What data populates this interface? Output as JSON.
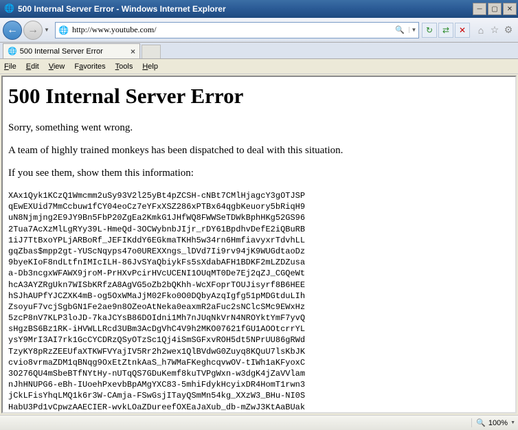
{
  "titlebar": {
    "text": "500 Internal Server Error - Windows Internet Explorer"
  },
  "address": {
    "url": "http://www.youtube.com/"
  },
  "tab": {
    "title": "500 Internal Server Error"
  },
  "menu": {
    "file": "File",
    "edit": "Edit",
    "view": "View",
    "favorites": "Favorites",
    "tools": "Tools",
    "help": "Help"
  },
  "page": {
    "heading": "500 Internal Server Error",
    "p1": "Sorry, something went wrong.",
    "p2": "A team of highly trained monkeys has been dispatched to deal with this situation.",
    "p3": "If you see them, show them this information:",
    "trace": "XAx1Qyk1KCzQ1Wmcmm2uSy93V2l25yBt4pZCSH-cNBt7CMlHjagcY3gOTJSP\nqEwEXUid7MmCcbuw1fCY04eoCz7eYFxXSZ286xPTBx64qgbKeuory5bRiqH9\nuN8Njmjng2E9JY9Bn5FbP20ZgEa2KmkG1JHfWQ8FWWSeTDWkBphHKg52GS96\n2Tua7AcXzMlLgRYy39L-HmeQd-3OCWybnbJIjr_rDY61BpdhvDefE2iQBuRB\n1iJ7TtBxoYPLjARBoRf_JEFIKddY6EGkmaTKHh5w34rn6HmfiavyxrTdvhLL\ngqZbas$mpp2gt-YUScNqyps47o0UREXXngs_lDVd7Ii9rv94jK9WUGdtaoDz\n9byeKIoF8ndLtfnIMIcILH-86JvSYaQbiykFs5sXdabAFH1BDKF2mLZDZusa\na-Db3ncgxWFAWX9jroM-PrHXvPcirHVcUCENI1OUqMT0De7Ej2qZJ_CGQeWt\nhcA3AYZRgUkn7WISbKRfzA8AgVG5oZb2bQKhh-WcXFoprTOUJisyrf8B6HEE\nhSJhAUPfYJCZXK4mB-og5OxWMaJjM02Fko0O0DQbyAzqIgfg51pMDGtduLIh\nZsoyuF7vcjSgbGN1Fe2ae9n8OZeoAtNeka0eaxmR2aFuc2sNClcSMc9EWxHz\n5zcP8nV7KLP3loJD-7kaJCYsB86DOIdni1Mh7nJUqNkVrN4NROYktYmF7yvQ\nsHgzBS6Bz1RK-iHVWLLRcd3UBm3AcDgVhC4V9h2MKO07621fGU1AOOtcrrYL\nysY9MrI3AI7rk1GcCYCDRzQSyOTzSc1Qj4iSmSGFxvROH5dt5NPrUU86gRWd\nTzyKY8pRzZEEUfaXTKWFVYajIV5Rr2h2wex1QlBVdwG0Zuyq8KQuU7lsKbJK\ncvio8vrmaZDM1qBNqg9OxEtZtnkAaS_h7WMaFKeghcqvwOV-tIWh1aKFyoxC\n3O276QU4mSbeBTfNYtHy-nUTqQS7GDuKemf8kuTVPgWxn-w3dgK4jZaVVlam\nnJhHNUPG6-eBh-IUoehPxevbBpAMgYXC83-5mhiFdykHcyixDR4HomT1rwn3\njCkLFisYhqLMQ1k6r3W-CAmja-FSwGsjITayQSmMn54kg_XXzW3_BHu-NI0S\nHabU3Pd1vCpwzAAECIER-wvkLOaZDureefOXEaJaXub_db-mZwJ3KtAaBUak"
  },
  "status": {
    "zoom": "100%"
  }
}
